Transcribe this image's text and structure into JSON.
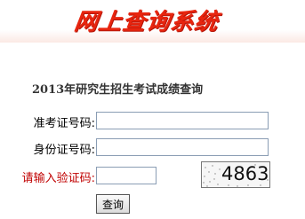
{
  "banner": {
    "title": "网上查询系统"
  },
  "page_title": "2013年研究生招生考试成绩查询",
  "form": {
    "exam_id": {
      "label": "准考证号码:",
      "value": ""
    },
    "id_card": {
      "label": "身份证号码:",
      "value": ""
    },
    "verify_code": {
      "label": "请输入验证码:",
      "value": ""
    },
    "captcha_text": "4863",
    "submit_label": "查询"
  },
  "colors": {
    "banner_red": "#e8250f",
    "label_red": "#c00000",
    "input_border": "#8a9db4"
  }
}
